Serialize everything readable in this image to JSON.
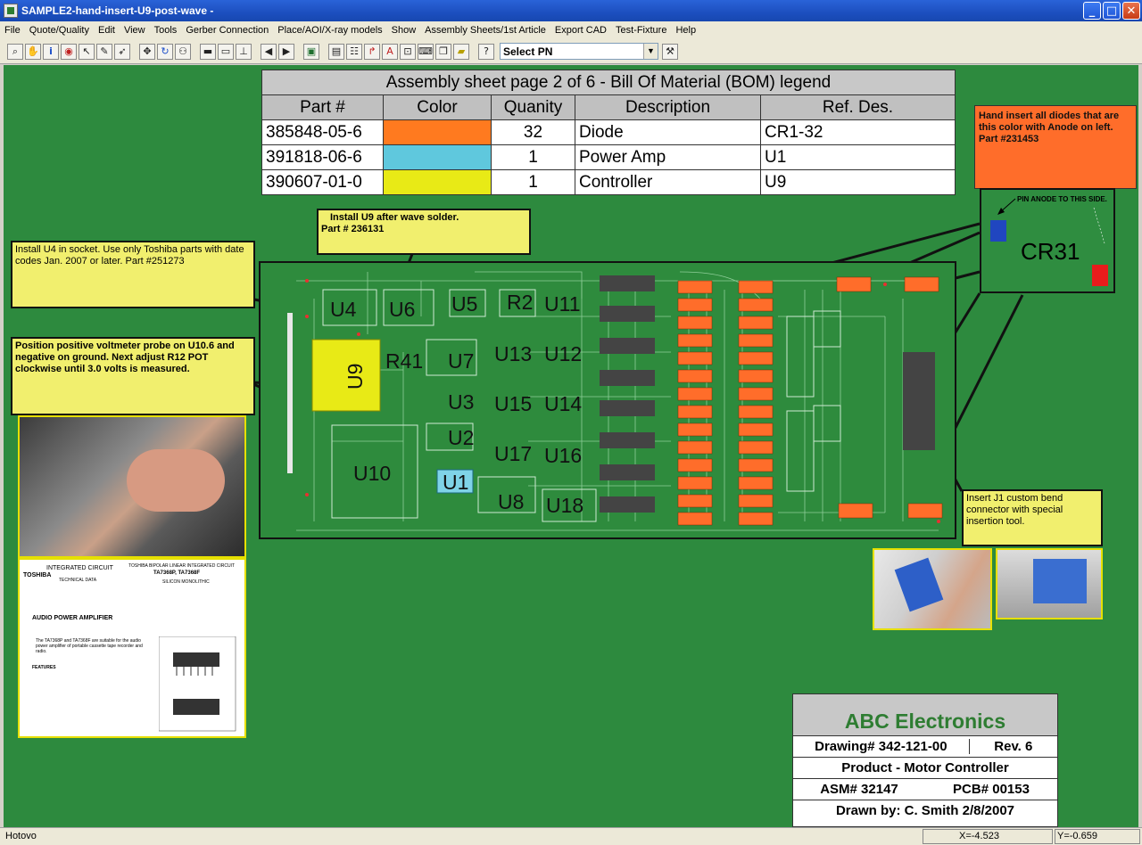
{
  "window": {
    "title": "SAMPLE2-hand-insert-U9-post-wave -"
  },
  "menu": [
    "File",
    "Quote/Quality",
    "Edit",
    "View",
    "Tools",
    "Gerber Connection",
    "Place/AOI/X-ray models",
    "Show",
    "Assembly Sheets/1st Article",
    "Export CAD",
    "Test-Fixture",
    "Help"
  ],
  "toolbar": {
    "select_pn": "Select PN"
  },
  "bom": {
    "caption": "Assembly sheet page 2 of 6 - Bill Of Material (BOM) legend",
    "headers": [
      "Part #",
      "Color",
      "Quanity",
      "Description",
      "Ref. Des."
    ],
    "rows": [
      {
        "part": "385848-05-6",
        "color": "#ff7a1f",
        "qty": "32",
        "desc": "Diode",
        "ref": "CR1-32"
      },
      {
        "part": "391818-06-6",
        "color": "#5fc8dd",
        "qty": "1",
        "desc": "Power Amp",
        "ref": "U1"
      },
      {
        "part": "390607-01-0",
        "color": "#e8ea16",
        "qty": "1",
        "desc": "Controller",
        "ref": "U9"
      }
    ]
  },
  "notes": {
    "u9": "Install U9 after wave solder.",
    "u9_part": "Part # 236131",
    "u4": "Install U4 in socket. Use only Toshiba parts with date codes Jan. 2007 or later. Part #251273",
    "u10": "Position positive voltmeter probe on U10.6 and negative on ground.  Next adjust R12 POT clockwise until 3.0 volts is measured.",
    "diodes": "Hand insert all       diodes that are this color with Anode on left.  Part #231453",
    "j1": "Insert J1 custom bend connector with special insertion tool."
  },
  "cr31": {
    "label": "CR31",
    "pin_note": "PIN  ANODE TO THIS SIDE."
  },
  "pcb": {
    "labels": [
      "U4",
      "U6",
      "U5",
      "R2",
      "U11",
      "U9",
      "R41",
      "U7",
      "U13",
      "U12",
      "U3",
      "U15",
      "U14",
      "U2",
      "U17",
      "U16",
      "U10",
      "U1",
      "U8",
      "U18"
    ]
  },
  "datasheet": {
    "brand": "TOSHIBA",
    "header1": "INTEGRATED  CIRCUIT",
    "header2": "TECHNICAL  DATA",
    "header3": "TOSHIBA BIPOLAR LINEAR INTEGRATED CIRCUIT",
    "part": "TA7368P, TA7368F",
    "sub": "SILICON MONOLITHIC",
    "title": "AUDIO POWER AMPLIFIER",
    "body": "The TA7368P and TA7368F are suitable for the audio power amplifier of portable cassette tape recorder and radio.",
    "features": "FEATURES"
  },
  "titleblock": {
    "company": "ABC Electronics",
    "drawing": "Drawing# 342-121-00",
    "rev": "Rev. 6",
    "product": "Product - Motor Controller",
    "asm": "ASM# 32147",
    "pcb": "PCB# 00153",
    "drawn": "Drawn by: C. Smith  2/8/2007"
  },
  "status": {
    "left": "Hotovo",
    "x": "X=-4.523",
    "y": "Y=-0.659"
  },
  "colors": {
    "canvas": "#2d8a3e",
    "note": "#f1ef6e",
    "diode": "#ff6d2a",
    "u9": "#e8ea16",
    "u1": "#7fd3e8"
  }
}
